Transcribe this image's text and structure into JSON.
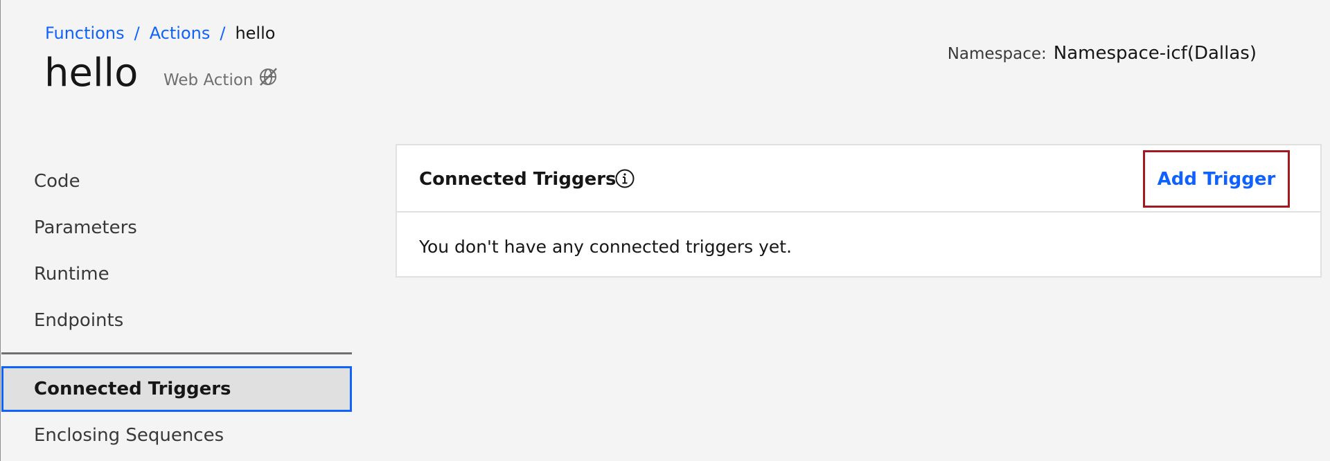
{
  "breadcrumb": {
    "items": [
      "Functions",
      "Actions"
    ],
    "separator": "/",
    "current": "hello"
  },
  "header": {
    "title": "hello",
    "web_action_label": "Web Action",
    "web_action_icon": "web-action-disabled-icon",
    "namespace_label": "Namespace:",
    "namespace_value": "Namespace-icf(Dallas)"
  },
  "sidebar": {
    "items": [
      {
        "label": "Code"
      },
      {
        "label": "Parameters"
      },
      {
        "label": "Runtime"
      },
      {
        "label": "Endpoints"
      },
      {
        "label": "Connected Triggers",
        "active": true
      },
      {
        "label": "Enclosing Sequences"
      }
    ]
  },
  "panel": {
    "title": "Connected Triggers",
    "info_icon": "info-icon",
    "add_button_label": "Add Trigger",
    "empty_message": "You don't have any connected triggers yet."
  },
  "colors": {
    "accent": "#0f62fe",
    "highlight_border": "#a2191f",
    "background": "#f4f4f4"
  }
}
